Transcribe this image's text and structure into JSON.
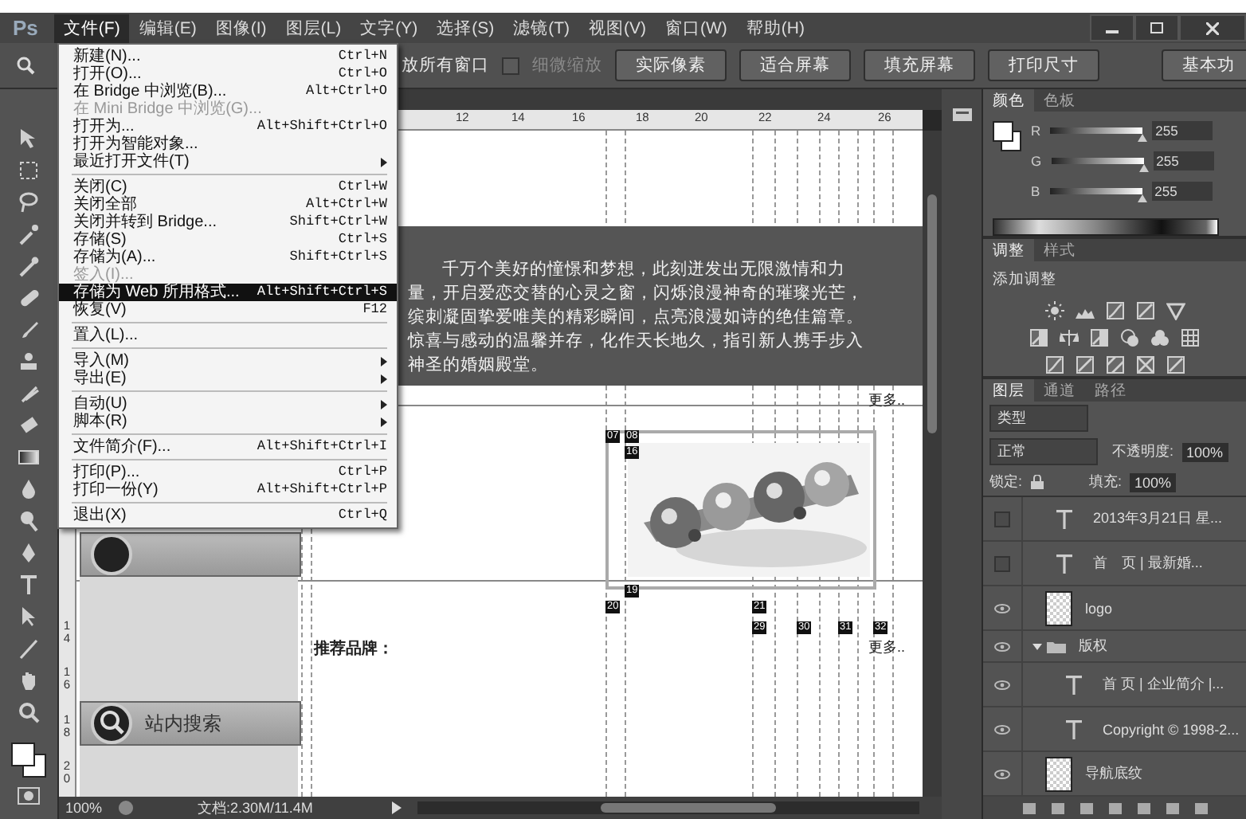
{
  "app": {
    "logo": "Ps"
  },
  "menubar": [
    {
      "label": "文件(F)",
      "selected": true
    },
    {
      "label": "编辑(E)",
      "selected": false
    },
    {
      "label": "图像(I)",
      "selected": false
    },
    {
      "label": "图层(L)",
      "selected": false
    },
    {
      "label": "文字(Y)",
      "selected": false
    },
    {
      "label": "选择(S)",
      "selected": false
    },
    {
      "label": "滤镜(T)",
      "selected": false
    },
    {
      "label": "视图(V)",
      "selected": false
    },
    {
      "label": "窗口(W)",
      "selected": false
    },
    {
      "label": "帮助(H)",
      "selected": false
    }
  ],
  "options_bar": {
    "zoom_all_label": "放所有窗口",
    "scrubby_zoom": {
      "label": "细微缩放",
      "checked": false,
      "disabled": true
    },
    "buttons": [
      "实际像素",
      "适合屏幕",
      "填充屏幕",
      "打印尺寸"
    ],
    "workspace": "基本功"
  },
  "file_menu": {
    "groups": [
      [
        {
          "label": "新建(N)...",
          "shortcut": "Ctrl+N",
          "disabled": false,
          "selected": false,
          "submenu": false
        },
        {
          "label": "打开(O)...",
          "shortcut": "Ctrl+O",
          "disabled": false,
          "selected": false,
          "submenu": false
        },
        {
          "label": "在 Bridge 中浏览(B)...",
          "shortcut": "Alt+Ctrl+O",
          "disabled": false,
          "selected": false,
          "submenu": false
        },
        {
          "label": "在 Mini Bridge 中浏览(G)...",
          "disabled": true,
          "selected": false,
          "submenu": false
        },
        {
          "label": "打开为...",
          "shortcut": "Alt+Shift+Ctrl+O",
          "disabled": false,
          "selected": false,
          "submenu": false
        },
        {
          "label": "打开为智能对象...",
          "disabled": false,
          "selected": false,
          "submenu": false
        },
        {
          "label": "最近打开文件(T)",
          "disabled": false,
          "selected": false,
          "submenu": true
        }
      ],
      [
        {
          "label": "关闭(C)",
          "shortcut": "Ctrl+W",
          "disabled": false,
          "selected": false,
          "submenu": false
        },
        {
          "label": "关闭全部",
          "shortcut": "Alt+Ctrl+W",
          "disabled": false,
          "selected": false,
          "submenu": false
        },
        {
          "label": "关闭并转到 Bridge...",
          "shortcut": "Shift+Ctrl+W",
          "disabled": false,
          "selected": false,
          "submenu": false
        },
        {
          "label": "存储(S)",
          "shortcut": "Ctrl+S",
          "disabled": false,
          "selected": false,
          "submenu": false
        },
        {
          "label": "存储为(A)...",
          "shortcut": "Shift+Ctrl+S",
          "disabled": false,
          "selected": false,
          "submenu": false
        },
        {
          "label": "签入(I)...",
          "disabled": true,
          "selected": false,
          "submenu": false
        },
        {
          "label": "存储为 Web 所用格式...",
          "shortcut": "Alt+Shift+Ctrl+S",
          "disabled": false,
          "selected": true,
          "submenu": false
        },
        {
          "label": "恢复(V)",
          "shortcut": "F12",
          "disabled": false,
          "selected": false,
          "submenu": false
        }
      ],
      [
        {
          "label": "置入(L)...",
          "disabled": false,
          "selected": false,
          "submenu": false
        }
      ],
      [
        {
          "label": "导入(M)",
          "disabled": false,
          "selected": false,
          "submenu": true
        },
        {
          "label": "导出(E)",
          "disabled": false,
          "selected": false,
          "submenu": true
        }
      ],
      [
        {
          "label": "自动(U)",
          "disabled": false,
          "selected": false,
          "submenu": true
        },
        {
          "label": "脚本(R)",
          "disabled": false,
          "selected": false,
          "submenu": true
        }
      ],
      [
        {
          "label": "文件简介(F)...",
          "shortcut": "Alt+Shift+Ctrl+I",
          "disabled": false,
          "selected": false,
          "submenu": false
        }
      ],
      [
        {
          "label": "打印(P)...",
          "shortcut": "Ctrl+P",
          "disabled": false,
          "selected": false,
          "submenu": false
        },
        {
          "label": "打印一份(Y)",
          "shortcut": "Alt+Shift+Ctrl+P",
          "disabled": false,
          "selected": false,
          "submenu": false
        }
      ],
      [
        {
          "label": "退出(X)",
          "shortcut": "Ctrl+Q",
          "disabled": false,
          "selected": false,
          "submenu": false
        }
      ]
    ]
  },
  "document": {
    "top_ruler": [
      "12",
      "14",
      "16",
      "18",
      "20",
      "22",
      "24",
      "26"
    ],
    "left_ruler": [
      "14",
      "16",
      "18",
      "20"
    ],
    "paragraph": "千万个美好的憧憬和梦想，此刻迸发出无限激情和力量，开启爱恋交替的心灵之窗，闪烁浪漫神奇的璀璨光芒，缤刺凝固挚爱唯美的精彩瞬间，点亮浪漫如诗的绝佳篇章。惊喜与感动的温馨并存，化作天长地久，指引新人携手步入神圣的婚姻殿堂。",
    "more_links": [
      "更多..",
      "更多.."
    ],
    "brand_label": "推荐品牌：",
    "search_label": "站内搜索",
    "slices": [
      "07",
      "08",
      "16",
      "19",
      "20",
      "21",
      "29",
      "30",
      "31",
      "32"
    ]
  },
  "status_bar": {
    "zoom": "100%",
    "doc_info": "文档:2.30M/11.4M"
  },
  "color_panel": {
    "tabs": [
      {
        "label": "颜色",
        "selected": true
      },
      {
        "label": "色板",
        "selected": false
      }
    ],
    "channels": [
      {
        "name": "R",
        "value": "255",
        "level": 1
      },
      {
        "name": "G",
        "value": "255",
        "level": 1
      },
      {
        "name": "B",
        "value": "255",
        "level": 1
      }
    ]
  },
  "adjustments_panel": {
    "tabs": [
      {
        "label": "调整",
        "selected": true
      },
      {
        "label": "样式",
        "selected": false
      }
    ],
    "title": "添加调整"
  },
  "layers_panel": {
    "tabs": [
      {
        "label": "图层",
        "selected": true
      },
      {
        "label": "通道",
        "selected": false
      },
      {
        "label": "路径",
        "selected": false
      }
    ],
    "filter": "类型",
    "blend_mode": "正常",
    "opacity_label": "不透明度:",
    "opacity": "100%",
    "lock_label": "锁定:",
    "fill_label": "填充:",
    "fill": "100%",
    "layers": [
      {
        "kind": "text",
        "name": "2013年3月21日 星...",
        "visible": false
      },
      {
        "kind": "text",
        "name": "首　页 | 最新婚...",
        "visible": false
      },
      {
        "name": "logo",
        "visible": true
      },
      {
        "kind": "group",
        "name": "版权",
        "visible": true,
        "expanded": true,
        "children": [
          {
            "kind": "text",
            "name": "首 页 | 企业简介 |...",
            "visible": true
          },
          {
            "kind": "text",
            "name": "Copyright © 1998-2...",
            "visible": true
          }
        ]
      },
      {
        "name": "导航底纹",
        "visible": true
      }
    ]
  }
}
